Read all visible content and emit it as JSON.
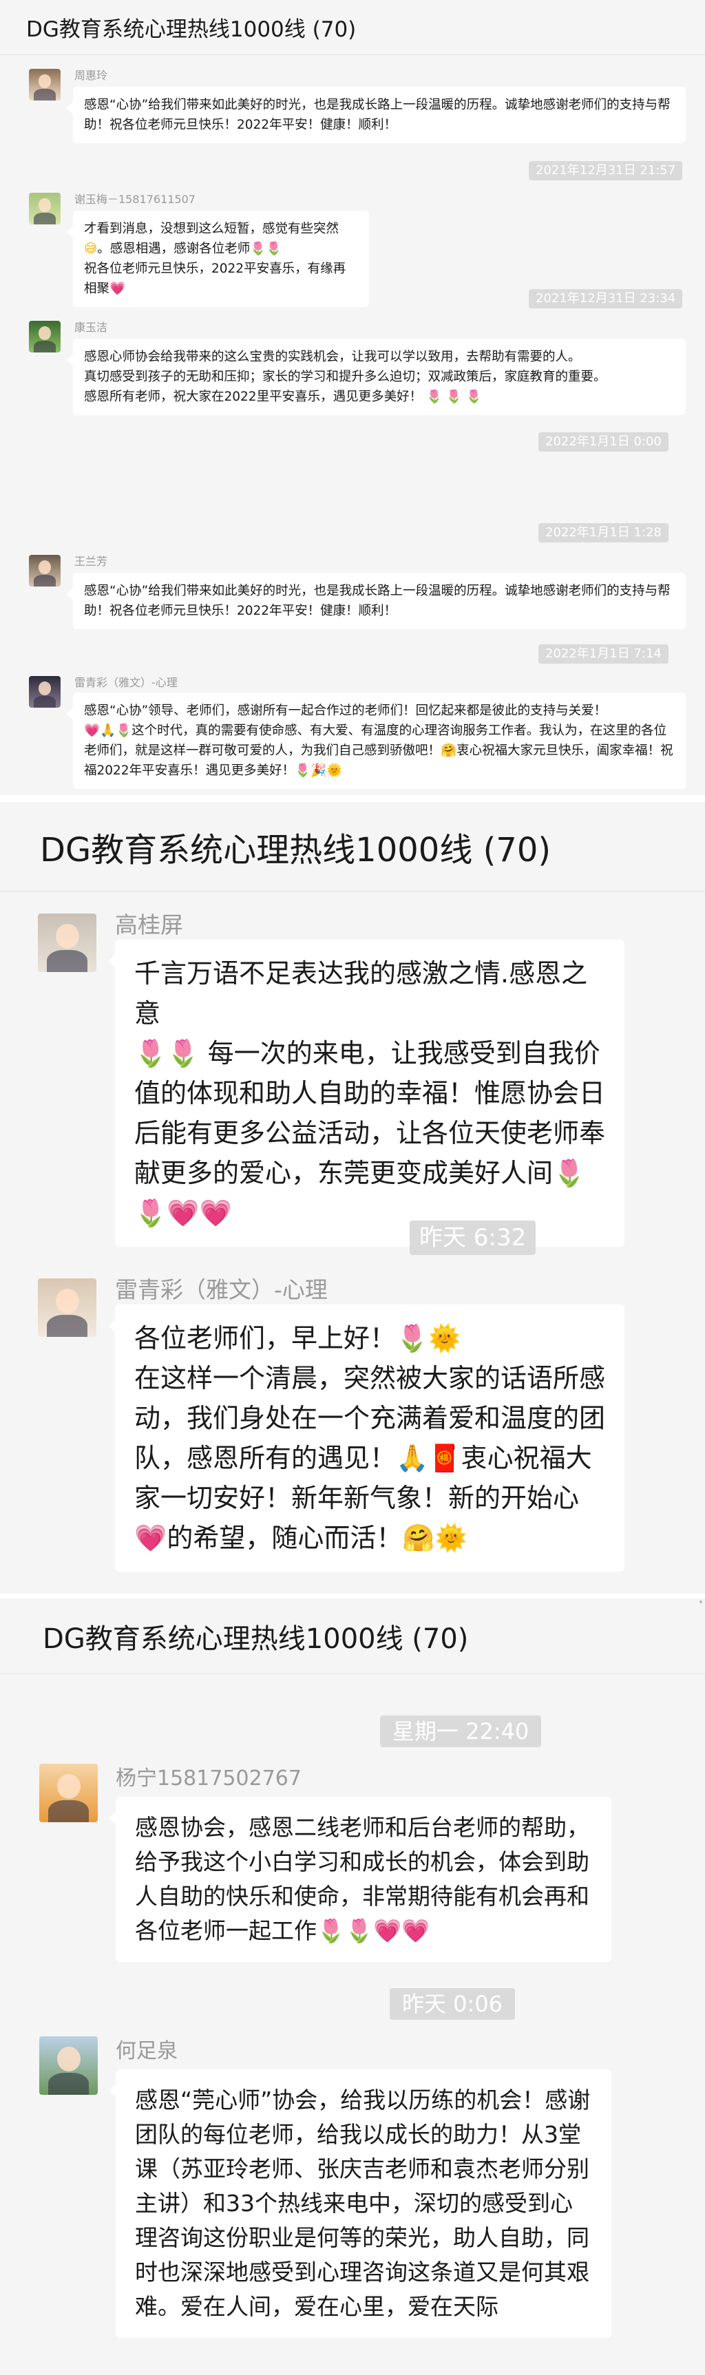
{
  "screen1": {
    "title": "DG教育系统心理热线1000线 (70)",
    "messages": [
      {
        "sender": "周惠玲",
        "text": "感恩“心协”给我们带来如此美好的时光，也是我成长路上一段温暖的历程。诚挚地感谢老师们的支持与帮助！祝各位老师元旦快乐！2022年平安！健康！顺利！"
      },
      {
        "sender": "谢玉梅－15817611507",
        "text_a": "才看到消息，没想到这么短暂，感觉有些突然",
        "text_b": "。感恩相遇，感谢各位老师",
        "text_c": "祝各位老师元旦快乐，2022平安喜乐，有缘再相聚"
      },
      {
        "sender": "康玉洁",
        "text_a": "感恩心师协会给我带来的这么宝贵的实践机会，让我可以学以致用，去帮助有需要的人。",
        "text_b": "真切感受到孩子的无助和压抑；家长的学习和提升多么迫切；双减政策后，家庭教育的重要。",
        "text_c": "感恩所有老师，祝大家在2022里平安喜乐，遇见更多美好！"
      },
      {
        "sender": "王兰芳",
        "text": "感恩“心协”给我们带来如此美好的时光，也是我成长路上一段温暖的历程。诚挚地感谢老师们的支持与帮助！祝各位老师元旦快乐！2022年平安！健康！顺利！"
      },
      {
        "sender": "雷青彩（雅文）-心理",
        "text_a": "感恩“心协”领导、老师们，感谢所有一起合作过的老师们！回忆起来都是彼此的支持与关爱！",
        "text_b": "这个时代，真的需要有使命感、有大爱、有温度的心理咨询服务工作者。我认为，在这里的各位老师们，就是这样一群可敬可爱的人，为我们自己感到骄傲吧！",
        "text_c": "衷心祝福大家元旦快乐，阖家幸福！祝福2022年平安喜乐！遇见更多美好！"
      }
    ],
    "timestamps": [
      "2021年12月31日 21:57",
      "2021年12月31日 23:34",
      "2022年1月1日 0:00",
      "2022年1月1日 1:28",
      "2022年1月1日 7:14"
    ]
  },
  "screen2": {
    "title": "DG教育系统心理热线1000线 (70)",
    "messages": [
      {
        "sender": "高桂屏",
        "text_a": "千言万语不足表达我的感激之情.感恩之意",
        "text_b": "每一次的来电，让我感受到自我价值的体现和助人自助的幸福！惟愿协会日后能有更多公益活动，让各位天使老师奉献更多的爱心，东莞更变成美好人间"
      },
      {
        "sender": "雷青彩（雅文）-心理",
        "text_a": "各位老师们，早上好！",
        "text_b": "在这样一个清晨，突然被大家的话语所感动，我们身处在一个充满着爱和温度的团队，感恩所有的遇见！",
        "text_c": "衷心祝福大家一切安好！新年新气象！新的开始心",
        "text_d": "的希望，随心而活！"
      }
    ],
    "timestamps": [
      "昨天 6:32"
    ]
  },
  "screen3": {
    "title": "DG教育系统心理热线1000线 (70)",
    "messages": [
      {
        "sender": "杨宁15817502767",
        "text": "感恩协会，感恩二线老师和后台老师的帮助，给予我这个小白学习和成长的机会，体会到助人自助的快乐和使命，非常期待能有机会再和各位老师一起工作"
      },
      {
        "sender": "何足泉",
        "text": "感恩“莞心师”协会，给我以历练的机会！感谢团队的每位老师，给我以成长的助力！从3堂课（苏亚玲老师、张庆吉老师和袁杰老师分别主讲）和33个热线来电中，深切的感受到心理咨询这份职业是何等的荣光，助人自助，同时也深深地感受到心理咨询这条道又是何其艰难。爱在人间，爱在心里，爱在天际"
      }
    ],
    "timestamps": [
      "星期一 22:40",
      "昨天 0:06"
    ]
  },
  "colors": {
    "bubble": "#ffffff",
    "background": "#f5f5f5",
    "timestamp_bg": "#dadada",
    "sender_text": "#9a9a9a"
  },
  "icons": [
    "tulip-emoji",
    "heart-emoji",
    "sun-emoji",
    "sweat-smile-emoji",
    "clap-emoji",
    "party-emoji",
    "hug-emoji",
    "fu-emoji"
  ]
}
